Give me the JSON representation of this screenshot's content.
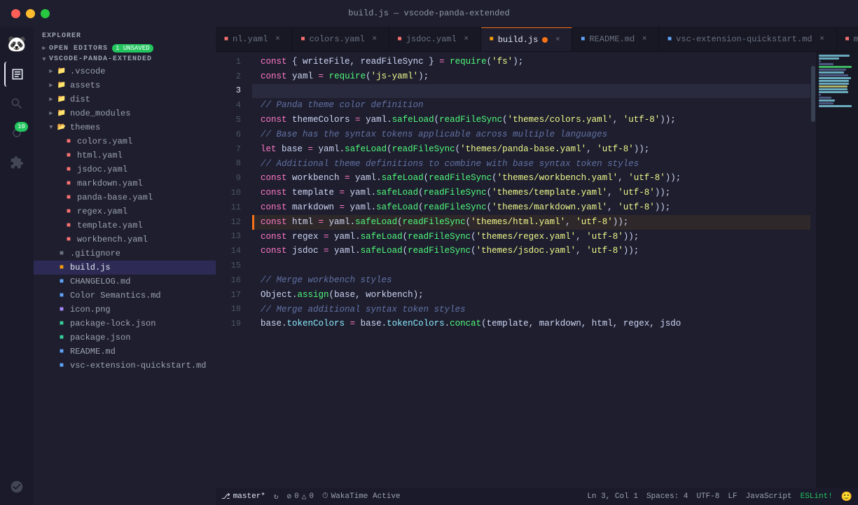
{
  "titlebar": {
    "title": "build.js — vscode-panda-extended"
  },
  "tabs": [
    {
      "id": "nl-yaml",
      "label": "nl.yaml",
      "color": "red",
      "active": false,
      "modified": false
    },
    {
      "id": "colors-yaml",
      "label": "colors.yaml",
      "color": "red",
      "active": false,
      "modified": false
    },
    {
      "id": "jsdoc-yaml",
      "label": "jsdoc.yaml",
      "color": "red",
      "active": false,
      "modified": false
    },
    {
      "id": "build-js",
      "label": "build.js",
      "color": "yellow",
      "active": true,
      "modified": true
    },
    {
      "id": "readme-md",
      "label": "README.md",
      "color": "blue",
      "active": false,
      "modified": false
    },
    {
      "id": "vsc-quickstart",
      "label": "vsc-extension-quickstart.md",
      "color": "blue",
      "active": false,
      "modified": false
    },
    {
      "id": "markdown-yaml",
      "label": "markdown.yaml",
      "color": "red",
      "active": false,
      "modified": false
    }
  ],
  "sidebar": {
    "explorer_title": "EXPLORER",
    "open_editors_title": "OPEN EDITORS",
    "open_editors_badge": "1 UNSAVED",
    "project_title": "VSCODE-PANDA-EXTENDED",
    "tree": [
      {
        "level": 1,
        "type": "folder",
        "name": ".vscode",
        "expanded": false
      },
      {
        "level": 1,
        "type": "folder",
        "name": "assets",
        "expanded": false
      },
      {
        "level": 1,
        "type": "folder",
        "name": "dist",
        "expanded": false
      },
      {
        "level": 1,
        "type": "folder",
        "name": "node_modules",
        "expanded": false
      },
      {
        "level": 1,
        "type": "folder",
        "name": "themes",
        "expanded": true
      },
      {
        "level": 2,
        "type": "file-red",
        "name": "colors.yaml"
      },
      {
        "level": 2,
        "type": "file-red",
        "name": "html.yaml"
      },
      {
        "level": 2,
        "type": "file-red",
        "name": "jsdoc.yaml"
      },
      {
        "level": 2,
        "type": "file-red",
        "name": "markdown.yaml"
      },
      {
        "level": 2,
        "type": "file-red",
        "name": "panda-base.yaml"
      },
      {
        "level": 2,
        "type": "file-red",
        "name": "regex.yaml"
      },
      {
        "level": 2,
        "type": "file-red",
        "name": "template.yaml"
      },
      {
        "level": 2,
        "type": "file-red",
        "name": "workbench.yaml"
      },
      {
        "level": 1,
        "type": "file-plain",
        "name": ".gitignore"
      },
      {
        "level": 1,
        "type": "file-active",
        "name": "build.js"
      },
      {
        "level": 1,
        "type": "file-md",
        "name": "CHANGELOG.md"
      },
      {
        "level": 1,
        "type": "file-md",
        "name": "Color Semantics.md"
      },
      {
        "level": 1,
        "type": "file-img",
        "name": "icon.png"
      },
      {
        "level": 1,
        "type": "file-json",
        "name": "package-lock.json"
      },
      {
        "level": 1,
        "type": "file-json",
        "name": "package.json"
      },
      {
        "level": 1,
        "type": "file-md",
        "name": "README.md"
      },
      {
        "level": 1,
        "type": "file-md",
        "name": "vsc-extension-quickstart.md"
      }
    ]
  },
  "code": {
    "lines": [
      {
        "num": 1,
        "content": "const { writeFile, readFileSync } = require('fs');"
      },
      {
        "num": 2,
        "content": "const yaml = require('js-yaml');"
      },
      {
        "num": 3,
        "content": ""
      },
      {
        "num": 4,
        "content": "// Panda theme color definition"
      },
      {
        "num": 5,
        "content": "const themeColors = yaml.safeLoad(readFileSync('themes/colors.yaml', 'utf-8'));"
      },
      {
        "num": 6,
        "content": "// Base has the syntax tokens applicable across multiple languages"
      },
      {
        "num": 7,
        "content": "let base = yaml.safeLoad(readFileSync('themes/panda-base.yaml', 'utf-8'));"
      },
      {
        "num": 8,
        "content": "// Additional theme definitions to combine with base syntax token styles"
      },
      {
        "num": 9,
        "content": "const workbench = yaml.safeLoad(readFileSync('themes/workbench.yaml', 'utf-8'));"
      },
      {
        "num": 10,
        "content": "const template = yaml.safeLoad(readFileSync('themes/template.yaml', 'utf-8'));"
      },
      {
        "num": 11,
        "content": "const markdown = yaml.safeLoad(readFileSync('themes/markdown.yaml', 'utf-8'));"
      },
      {
        "num": 12,
        "content": "const html = yaml.safeLoad(readFileSync('themes/html.yaml', 'utf-8'));"
      },
      {
        "num": 13,
        "content": "const regex = yaml.safeLoad(readFileSync('themes/regex.yaml', 'utf-8'));"
      },
      {
        "num": 14,
        "content": "const jsdoc = yaml.safeLoad(readFileSync('themes/jsdoc.yaml', 'utf-8'));"
      },
      {
        "num": 15,
        "content": ""
      },
      {
        "num": 16,
        "content": "// Merge workbench styles"
      },
      {
        "num": 17,
        "content": "Object.assign(base, workbench);"
      },
      {
        "num": 18,
        "content": "// Merge additional syntax token styles"
      },
      {
        "num": 19,
        "content": "base.tokenColors = base.tokenColors.concat(template, markdown, html, regex, jsdo"
      }
    ]
  },
  "status": {
    "branch": "master*",
    "sync": "⟳",
    "errors": "⊘ 0 △ 0",
    "wakatime": "WakaTime Active",
    "position": "Ln 3, Col 1",
    "spaces": "Spaces: 4",
    "encoding": "UTF-8",
    "line_ending": "LF",
    "language": "JavaScript",
    "eslint": "ESLint!"
  }
}
